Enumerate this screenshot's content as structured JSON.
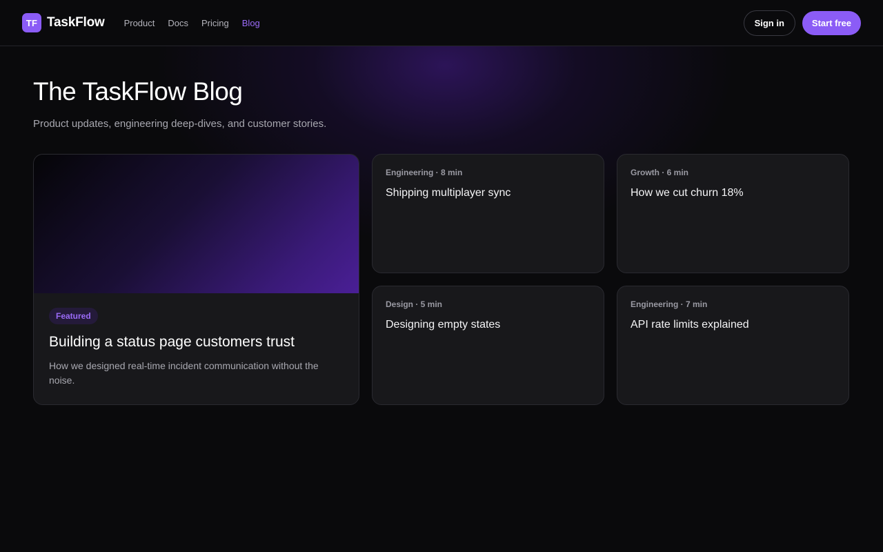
{
  "header": {
    "logo_mark": "TF",
    "brand_name": "TaskFlow",
    "nav": [
      {
        "label": "Product"
      },
      {
        "label": "Docs"
      },
      {
        "label": "Pricing"
      },
      {
        "label": "Blog",
        "active": true
      }
    ],
    "signin_label": "Sign in",
    "start_label": "Start free"
  },
  "hero": {
    "title": "The TaskFlow Blog",
    "subtitle": "Product updates, engineering deep-dives, and customer stories."
  },
  "featured": {
    "badge": "Featured",
    "title": "Building a status page customers trust",
    "excerpt": "How we designed real-time incident communication without the noise."
  },
  "posts": [
    {
      "meta": "Engineering · 8 min",
      "title": "Shipping multiplayer sync"
    },
    {
      "meta": "Growth · 6 min",
      "title": "How we cut churn 18%"
    },
    {
      "meta": "Design · 5 min",
      "title": "Designing empty states"
    },
    {
      "meta": "Engineering · 7 min",
      "title": "API rate limits explained"
    }
  ],
  "colors": {
    "accent": "#8b5cf6",
    "background": "#0a0a0c",
    "card": "#18181b"
  }
}
